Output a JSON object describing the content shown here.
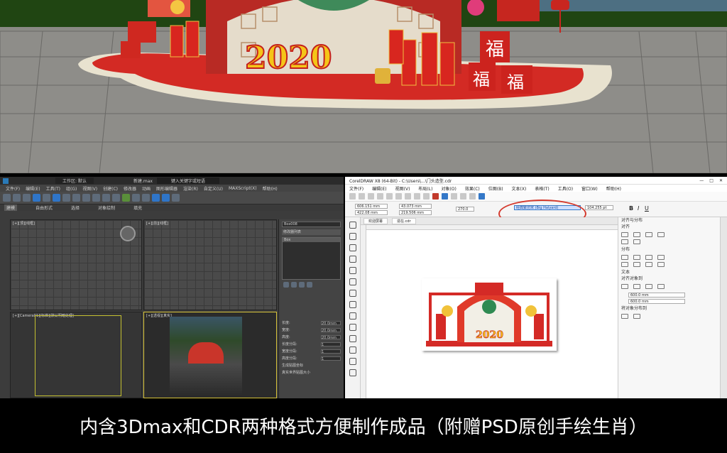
{
  "caption": "内含3Dmax和CDR两种格式方便制作成品（附赠PSD原创手绘生肖）",
  "render": {
    "year_text": "2020",
    "fu_char": "福"
  },
  "max_window": {
    "title_items": [
      "工作区: 默认",
      "新建.max",
      "键入关键字或短语"
    ],
    "menu": [
      "文件(F)",
      "编辑(E)",
      "工具(T)",
      "组(G)",
      "视图(V)",
      "创建(C)",
      "修改器",
      "动画",
      "图形编辑器",
      "渲染(R)",
      "自定义(U)",
      "MAXScript(X)",
      "帮助(H)"
    ],
    "tabs": [
      "建模",
      "自由形式",
      "选择",
      "对象绘制",
      "填充"
    ],
    "viewports": {
      "top_left": "[+][顶][线框]",
      "top_right": "[+][前][线框]",
      "bottom_left": "[+][Camera01][标准][默认明暗处理]",
      "bottom_right": "[+][透视][真实]"
    },
    "command_panel": {
      "object_name": "Box008",
      "modifier_list": "修改器列表",
      "modifier": "Box",
      "params": [
        {
          "label": "长度:",
          "value": "20.0mm"
        },
        {
          "label": "宽度:",
          "value": "20.0mm"
        },
        {
          "label": "高度:",
          "value": "20.0mm"
        },
        {
          "label": "长度分段:",
          "value": "1"
        },
        {
          "label": "宽度分段:",
          "value": "1"
        },
        {
          "label": "高度分段:",
          "value": "1"
        }
      ],
      "checkboxes": [
        "生成贴图坐标",
        "真实世界贴图大小"
      ]
    }
  },
  "cdr_window": {
    "title": "CorelDRAW X8 (64-Bit) - C:\\Users\\...\\门头造型.cdr",
    "menu": [
      "文件(F)",
      "编辑(E)",
      "视图(V)",
      "布局(L)",
      "对象(O)",
      "效果(C)",
      "位图(B)",
      "文本(X)",
      "表格(T)",
      "工具(O)",
      "窗口(W)",
      "帮助(H)"
    ],
    "props": {
      "x": "606.151 mm",
      "y": "422.08 mm",
      "w": "43.073 mm",
      "h": "219.506 mm",
      "angle": "270.0",
      "font": "经典繁仿宋 (Big Halyard)",
      "size": "104.255 pt"
    },
    "doc_tabs": [
      "欢迎屏幕",
      "造在.cdr"
    ],
    "right_panel": {
      "title": "对齐与分布",
      "align": "对齐",
      "distribute": "分布",
      "text": "文本",
      "align_to": "对齐对象到",
      "distribute_to": "将对象分布到",
      "coord_x": "600.0 mm",
      "coord_y": "600.0 mm"
    }
  },
  "colors": {
    "festive_red": "#d42a26",
    "gold": "#f5c518",
    "caption_bg": "#000000",
    "annotation": "#d43a2e"
  }
}
